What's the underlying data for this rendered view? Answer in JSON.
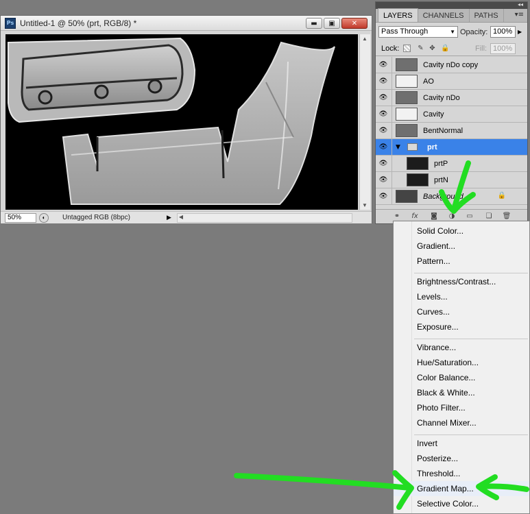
{
  "document": {
    "app_icon": "Ps",
    "title": "Untitled-1 @ 50% (prt, RGB/8) *",
    "zoom": "50%",
    "status": "Untagged RGB (8bpc)",
    "buttons": {
      "minimize": "▬",
      "restore": "▣",
      "close": "✕"
    }
  },
  "panel": {
    "collapse_glyph": "◂◂",
    "close_glyph": "✕",
    "menu_glyph": "▾≡",
    "tabs": [
      {
        "label": "LAYERS",
        "active": true
      },
      {
        "label": "CHANNELS",
        "active": false
      },
      {
        "label": "PATHS",
        "active": false
      }
    ],
    "blend_mode": "Pass Through",
    "opacity_label": "Opacity:",
    "opacity": "100%",
    "lock_label": "Lock:",
    "fill_label": "Fill:",
    "fill": "100%",
    "layers": [
      {
        "name": "Cavity nDo copy",
        "thumb": "mid"
      },
      {
        "name": "AO",
        "thumb": "white"
      },
      {
        "name": "Cavity nDo",
        "thumb": "mid"
      },
      {
        "name": "Cavity",
        "thumb": "white"
      },
      {
        "name": "BentNormal",
        "thumb": "mid"
      },
      {
        "name": "prt",
        "group": true,
        "selected": true
      },
      {
        "name": "prtP",
        "thumb": "dark",
        "child": true
      },
      {
        "name": "prtN",
        "thumb": "dark",
        "child": true
      },
      {
        "name": "Background",
        "thumb": "mid",
        "italic": true,
        "locked": true
      }
    ]
  },
  "menu": {
    "groups": [
      [
        "Solid Color...",
        "Gradient...",
        "Pattern..."
      ],
      [
        "Brightness/Contrast...",
        "Levels...",
        "Curves...",
        "Exposure..."
      ],
      [
        "Vibrance...",
        "Hue/Saturation...",
        "Color Balance...",
        "Black & White...",
        "Photo Filter...",
        "Channel Mixer..."
      ],
      [
        "Invert",
        "Posterize...",
        "Threshold...",
        "Gradient Map...",
        "Selective Color..."
      ]
    ],
    "items": {
      "solid_color": "Solid Color...",
      "gradient": "Gradient...",
      "pattern": "Pattern...",
      "brightness_contrast": "Brightness/Contrast...",
      "levels": "Levels...",
      "curves": "Curves...",
      "exposure": "Exposure...",
      "vibrance": "Vibrance...",
      "hue_saturation": "Hue/Saturation...",
      "color_balance": "Color Balance...",
      "black_white": "Black & White...",
      "photo_filter": "Photo Filter...",
      "channel_mixer": "Channel Mixer...",
      "invert": "Invert",
      "posterize": "Posterize...",
      "threshold": "Threshold...",
      "gradient_map": "Gradient Map...",
      "selective_color": "Selective Color..."
    },
    "highlighted": "Gradient Map..."
  },
  "annotation_color": "#22dd22"
}
